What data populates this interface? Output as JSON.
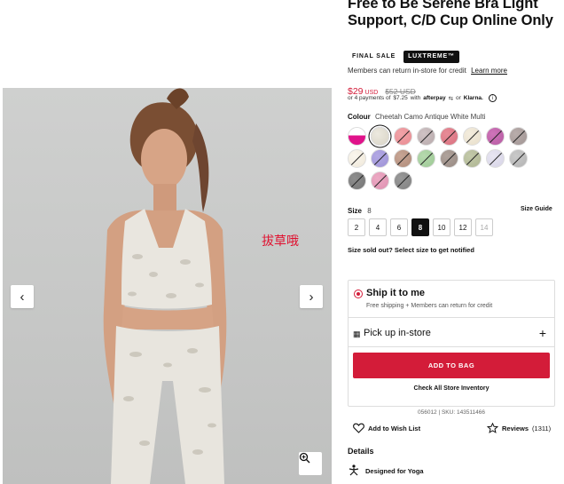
{
  "product": {
    "title": "Free to Be Serene Bra Light Support, C/D Cup Online Only",
    "badges": [
      "FINAL SALE",
      "LUXTREME™"
    ],
    "members_text": "Members can return in-store for credit",
    "learn_more": "Learn more",
    "price": "$29",
    "currency": "USD",
    "original_price": "$52 USD",
    "payments_prefix": "or 4 payments of",
    "payment_amount": "$7.25",
    "payments_with": "with",
    "afterpay": "afterpay",
    "or_text": "or",
    "klarna": "Klarna."
  },
  "colour": {
    "label": "Colour",
    "value": "Cheetah Camo Antique White Multi",
    "swatches": [
      {
        "name": "white-pink",
        "colors": [
          "#ffffff",
          "#e0128a"
        ],
        "unavailable": false,
        "selected": false
      },
      {
        "name": "cheetah-camo-antique-white",
        "colors": [
          "#ece9df",
          "#d9d4c6"
        ],
        "unavailable": false,
        "selected": true
      },
      {
        "name": "pink-pattern",
        "colors": [
          "#f1a3a8",
          "#e98c92"
        ],
        "unavailable": true,
        "selected": false
      },
      {
        "name": "grey-pattern",
        "colors": [
          "#cfc2c4",
          "#b7a9ab"
        ],
        "unavailable": true,
        "selected": false
      },
      {
        "name": "rose",
        "colors": [
          "#e78c97",
          "#d9707f"
        ],
        "unavailable": true,
        "selected": false
      },
      {
        "name": "cream",
        "colors": [
          "#f3ecdd",
          "#e8dfcb"
        ],
        "unavailable": true,
        "selected": false
      },
      {
        "name": "magenta",
        "colors": [
          "#cf74b9",
          "#b65aa2"
        ],
        "unavailable": true,
        "selected": false
      },
      {
        "name": "taupe",
        "colors": [
          "#b9adab",
          "#a19594"
        ],
        "unavailable": true,
        "selected": false
      },
      {
        "name": "ivory",
        "colors": [
          "#faf6ee",
          "#efe8d9"
        ],
        "unavailable": true,
        "selected": false
      },
      {
        "name": "lavender",
        "colors": [
          "#b3a9e4",
          "#9d92d6"
        ],
        "unavailable": true,
        "selected": false
      },
      {
        "name": "mocha",
        "colors": [
          "#c7a595",
          "#b08b79"
        ],
        "unavailable": true,
        "selected": false
      },
      {
        "name": "mint",
        "colors": [
          "#b6d9ae",
          "#9cc994"
        ],
        "unavailable": true,
        "selected": false
      },
      {
        "name": "brown-grey",
        "colors": [
          "#b0a39c",
          "#978982"
        ],
        "unavailable": true,
        "selected": false
      },
      {
        "name": "sage",
        "colors": [
          "#c3c9aa",
          "#aeb591"
        ],
        "unavailable": true,
        "selected": false
      },
      {
        "name": "pale-lilac",
        "colors": [
          "#e8e6f2",
          "#d6d3e6"
        ],
        "unavailable": true,
        "selected": false
      },
      {
        "name": "silver",
        "colors": [
          "#c9c9c9",
          "#b3b3b3"
        ],
        "unavailable": true,
        "selected": false
      },
      {
        "name": "charcoal",
        "colors": [
          "#8e8e8e",
          "#757575"
        ],
        "unavailable": true,
        "selected": false
      },
      {
        "name": "blush",
        "colors": [
          "#ecaac4",
          "#de90b0"
        ],
        "unavailable": true,
        "selected": false
      },
      {
        "name": "dark-grey",
        "colors": [
          "#999999",
          "#808080"
        ],
        "unavailable": true,
        "selected": false
      }
    ]
  },
  "size": {
    "label": "Size",
    "value": "8",
    "guide": "Size Guide",
    "options": [
      {
        "label": "2",
        "selected": false,
        "disabled": false
      },
      {
        "label": "4",
        "selected": false,
        "disabled": false
      },
      {
        "label": "6",
        "selected": false,
        "disabled": false
      },
      {
        "label": "8",
        "selected": true,
        "disabled": false
      },
      {
        "label": "10",
        "selected": false,
        "disabled": false
      },
      {
        "label": "12",
        "selected": false,
        "disabled": false
      },
      {
        "label": "14",
        "selected": false,
        "disabled": true
      }
    ],
    "sold_out_text": "Size sold out? Select size to get notified"
  },
  "shipping": {
    "ship_title": "Ship it to me",
    "ship_sub": "Free shipping + Members can return for credit",
    "pickup_label": "Pick up in-store",
    "add_to_bag": "ADD TO BAG",
    "check_inventory": "Check All Store Inventory"
  },
  "sku_text": "056012 | SKU: 143511466",
  "wishlist_label": "Add to Wish List",
  "reviews_label": "Reviews",
  "reviews_count": "(1311)",
  "details_label": "Details",
  "designed_for": "Designed for Yoga",
  "watermark": "拔草哦",
  "colors": {
    "accent_red": "#d31c39",
    "text_dark": "#111111"
  }
}
